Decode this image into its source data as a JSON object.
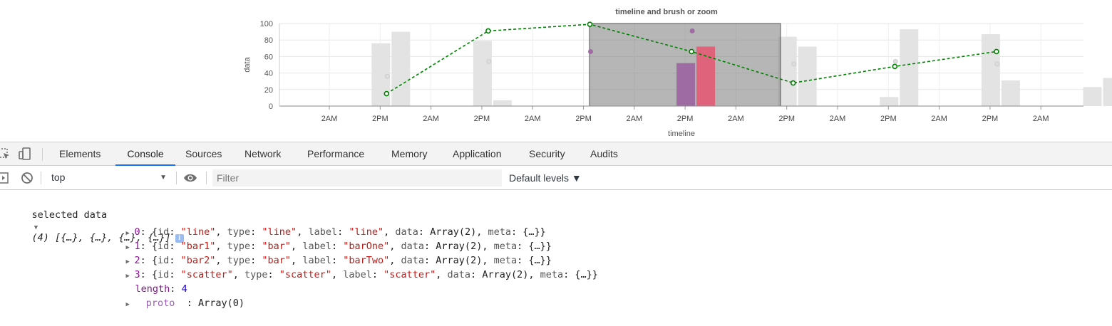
{
  "chart_data": {
    "type": "bar",
    "title": "timeline and brush or zoom",
    "xlabel": "timeline",
    "ylabel": "data",
    "ylim": [
      0,
      100
    ],
    "yticks": [
      0,
      20,
      40,
      60,
      80,
      100
    ],
    "xtick_labels": [
      "2AM",
      "2PM",
      "2AM",
      "2PM",
      "2AM",
      "2PM",
      "2AM",
      "2PM",
      "2AM",
      "2PM",
      "2AM",
      "2PM",
      "2AM",
      "2PM",
      "2AM"
    ],
    "grid": true,
    "legend": "none",
    "series": [
      {
        "type": "bar",
        "color": "#9e6ba3",
        "values": [
          76,
          79,
          0,
          52,
          84,
          11,
          87,
          23
        ]
      },
      {
        "type": "bar",
        "color": "#e0637c",
        "values": [
          90,
          7,
          0,
          72,
          72,
          93,
          31,
          34
        ]
      },
      {
        "type": "line",
        "color": "#008000",
        "values": [
          15,
          91,
          99,
          66,
          28,
          48,
          66
        ]
      },
      {
        "type": "scatter",
        "color": "#9e6ba3",
        "values": [
          36,
          54,
          66,
          91,
          51,
          54,
          51
        ]
      }
    ],
    "brush": {
      "from": "2PM",
      "to": "2PM",
      "highlighted": true
    }
  },
  "devtools": {
    "tabs": [
      "Elements",
      "Console",
      "Sources",
      "Network",
      "Performance",
      "Memory",
      "Application",
      "Security",
      "Audits"
    ],
    "selected_tab": "Console"
  },
  "toolbar": {
    "context": "top",
    "filter_placeholder": "Filter",
    "levels_label": "Default levels ▼"
  },
  "console": {
    "log_label": "selected data",
    "summary": "(4) [{…}, {…}, {…}, {…}]",
    "items": [
      {
        "index": "0",
        "id": "\"line\"",
        "type": "\"line\"",
        "label": "\"line\"",
        "data": "Array(2)",
        "meta": "{…}"
      },
      {
        "index": "1",
        "id": "\"bar1\"",
        "type": "\"bar\"",
        "label": "\"barOne\"",
        "data": "Array(2)",
        "meta": "{…}"
      },
      {
        "index": "2",
        "id": "\"bar2\"",
        "type": "\"bar\"",
        "label": "\"barTwo\"",
        "data": "Array(2)",
        "meta": "{…}"
      },
      {
        "index": "3",
        "id": "\"scatter\"",
        "type": "\"scatter\"",
        "label": "\"scatter\"",
        "data": "Array(2)",
        "meta": "{…}"
      }
    ],
    "length_key": "length",
    "length_value": "4",
    "proto_key": "proto",
    "proto_value": ": Array(0)"
  }
}
